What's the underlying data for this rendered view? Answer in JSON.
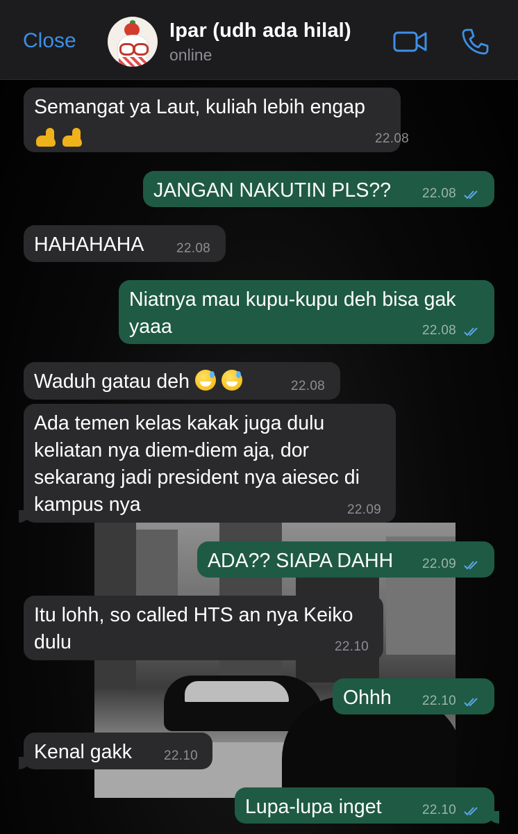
{
  "header": {
    "close_label": "Close",
    "contact_name": "Ipar (udh ada hilal)",
    "status": "online",
    "icons": [
      "avatar",
      "video-call-icon",
      "phone-call-icon"
    ]
  },
  "colors": {
    "accent": "#3d8fe6",
    "incoming_bubble": "#2a2a2c",
    "outgoing_bubble": "#1f5a45",
    "read_ticks": "#5aa7e8"
  },
  "messages": [
    {
      "direction": "in",
      "text": "Semangat ya Laut, kuliah lebih engap",
      "emoji": "flexed-biceps x2",
      "time": "22.08"
    },
    {
      "direction": "out",
      "text": "JANGAN NAKUTIN PLS??",
      "time": "22.08",
      "read": true
    },
    {
      "direction": "in",
      "text": "HAHAHAHA",
      "time": "22.08"
    },
    {
      "direction": "out",
      "text": "Niatnya mau kupu-kupu deh bisa gak\nyaaa",
      "time": "22.08",
      "read": true
    },
    {
      "direction": "in",
      "text": "Waduh gatau deh",
      "emoji": "grinning-sweat x2",
      "time": "22.08"
    },
    {
      "direction": "in",
      "text": "Ada temen kelas kakak juga dulu\nkeliatan nya diem-diem aja, dor\nsekarang jadi president nya aiesec di\nkampus nya",
      "time": "22.09"
    },
    {
      "direction": "out",
      "text": "ADA?? SIAPA DAHH",
      "time": "22.09",
      "read": true
    },
    {
      "direction": "in",
      "text": "Itu lohh, so called HTS an nya Keiko\ndulu",
      "time": "22.10"
    },
    {
      "direction": "out",
      "text": "Ohhh",
      "time": "22.10",
      "read": true
    },
    {
      "direction": "in",
      "text": "Kenal gakk",
      "time": "22.10"
    },
    {
      "direction": "out",
      "text": "Lupa-lupa inget",
      "time": "22.10",
      "read": true
    }
  ]
}
